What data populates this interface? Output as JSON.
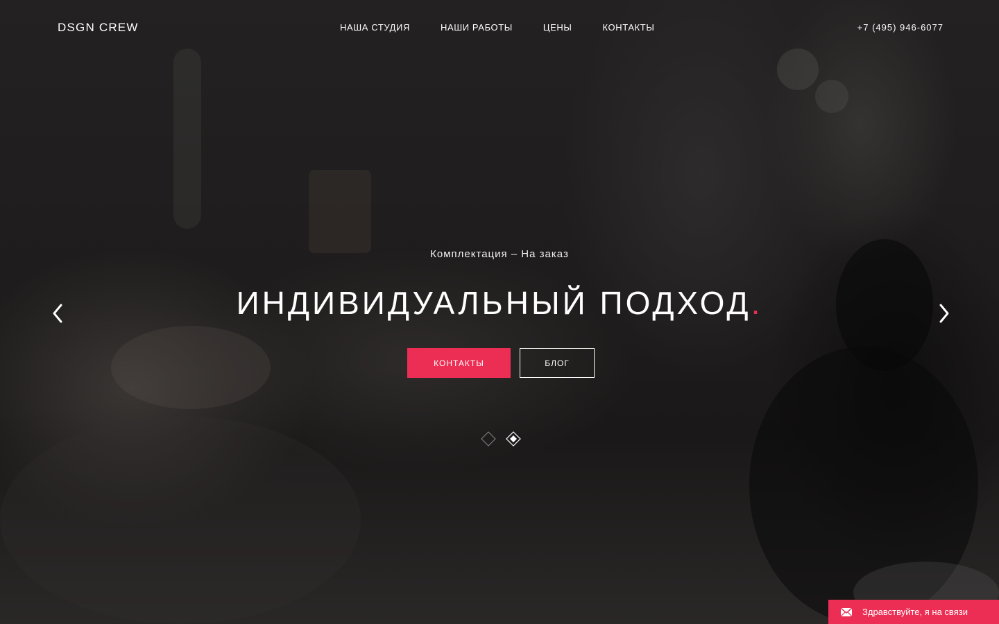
{
  "header": {
    "logo": "DSGN CREW",
    "nav": [
      {
        "label": "НАША СТУДИЯ"
      },
      {
        "label": "НАШИ РАБОТЫ"
      },
      {
        "label": "ЦЕНЫ"
      },
      {
        "label": "КОНТАКТЫ"
      }
    ],
    "phone": "+7 (495) 946-6077"
  },
  "slide": {
    "subtitle": "Комплектация – На заказ",
    "headline": "ИНДИВИДУАЛЬНЫЙ ПОДХОД",
    "headline_accent": ".",
    "primary_button": "КОНТАКТЫ",
    "secondary_button": "БЛОГ"
  },
  "slider": {
    "total_slides": 2,
    "active_slide": 2
  },
  "chat": {
    "label": "Здравствуйте, я на связи"
  },
  "colors": {
    "accent": "#ec2e54",
    "text": "#ffffff"
  },
  "icons": {
    "prev": "chevron-left-icon",
    "next": "chevron-right-icon",
    "chat": "envelope-icon"
  }
}
